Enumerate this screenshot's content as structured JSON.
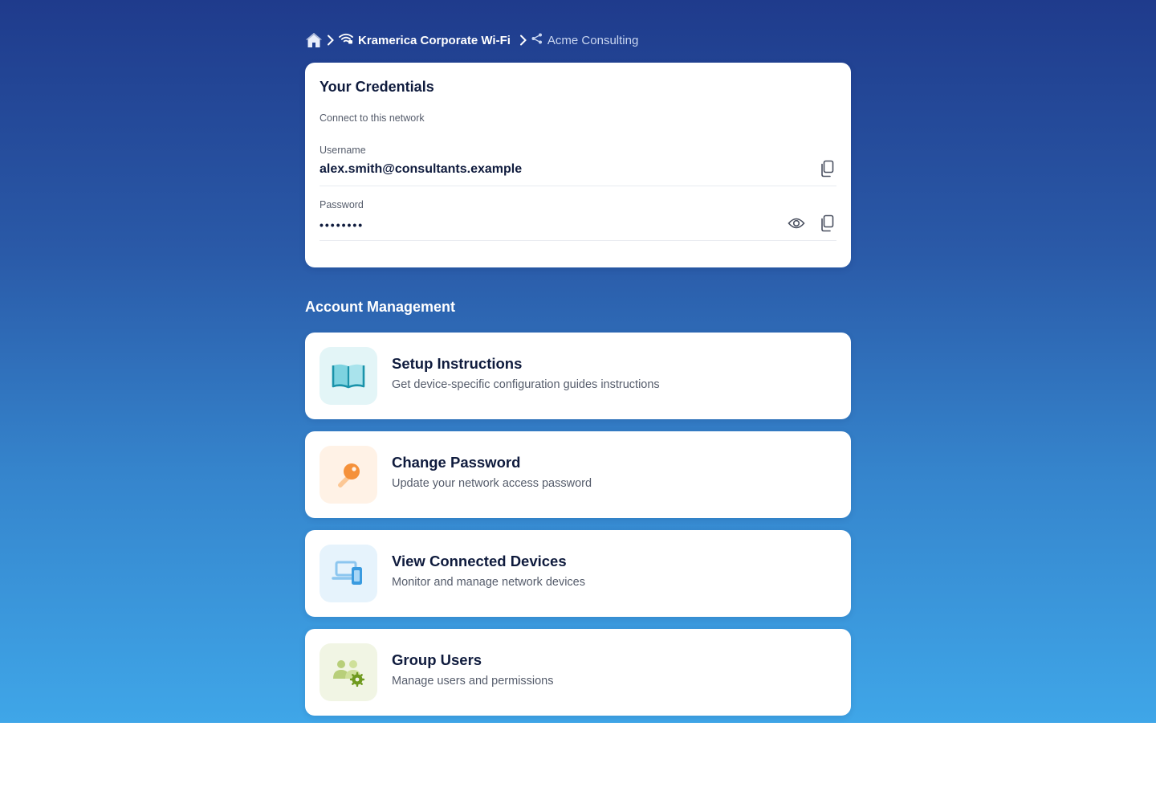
{
  "breadcrumb": {
    "home_icon": "home-icon",
    "network_label": "Kramerica Corporate Wi-Fi",
    "network_icon": "wifi-icon",
    "org_label": "Acme Consulting",
    "org_icon": "share-nodes-icon"
  },
  "credentials": {
    "title": "Your Credentials",
    "subtitle": "Connect to this network",
    "username_label": "Username",
    "username_value": "alex.smith@consultants.example",
    "password_label": "Password",
    "password_value": "••••••••"
  },
  "account_management": {
    "title": "Account Management",
    "items": [
      {
        "title": "Setup Instructions",
        "description": "Get device-specific configuration guides instructions",
        "icon": "book-icon",
        "icon_bg": "#e3f5f7",
        "icon_color": "#1aa3b8"
      },
      {
        "title": "Change Password",
        "description": "Update your network access password",
        "icon": "key-icon",
        "icon_bg": "#fff2e6",
        "icon_color": "#f5913a"
      },
      {
        "title": "View Connected Devices",
        "description": "Monitor and manage network devices",
        "icon": "devices-icon",
        "icon_bg": "#e6f3fc",
        "icon_color": "#3a9be0"
      },
      {
        "title": "Group Users",
        "description": "Manage users and permissions",
        "icon": "users-gear-icon",
        "icon_bg": "#f1f5e4",
        "icon_color": "#8fb13a"
      }
    ]
  },
  "colors": {
    "gradient_top": "#1f3b8c",
    "gradient_bottom": "#3fa6e8",
    "card_bg": "#ffffff",
    "text_primary": "#0f1b3d",
    "text_secondary": "#555c6b"
  }
}
